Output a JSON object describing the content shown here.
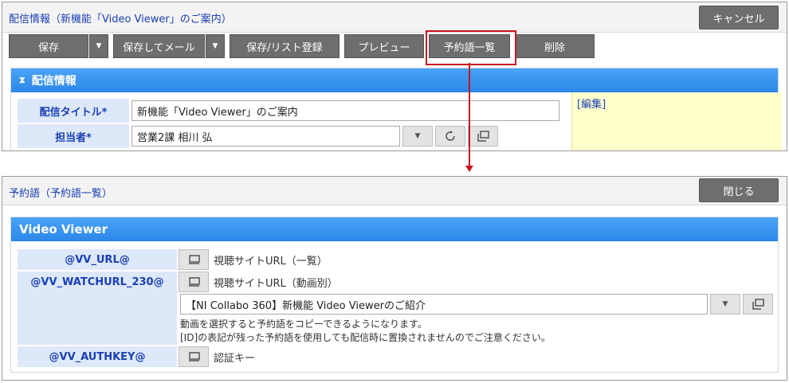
{
  "top_panel": {
    "title": "配信情報（新機能「Video Viewer」のご案内）",
    "cancel_label": "キャンセル",
    "toolbar": {
      "save": "保存",
      "save_and_mail": "保存してメール",
      "save_list": "保存/リスト登録",
      "preview": "プレビュー",
      "reserved_words": "予約語一覧",
      "delete": "削除"
    },
    "section_title": "配信情報",
    "fields": {
      "title_label": "配信タイトル*",
      "title_value": "新機能「Video Viewer」のご案内",
      "owner_label": "担当者*",
      "owner_value": "営業2課 相川 弘"
    },
    "edit_link": "[編集]"
  },
  "bottom_panel": {
    "title": "予約語（予約語一覧）",
    "close_label": "閉じる",
    "section_title": "Video Viewer",
    "rows": [
      {
        "key": "@VV_URL@",
        "desc": "視聴サイトURL（一覧）"
      },
      {
        "key": "@VV_WATCHURL_230@",
        "desc": "視聴サイトURL（動画別）"
      },
      {
        "key": "@VV_AUTHKEY@",
        "desc": "認証キー"
      }
    ],
    "video_select_value": "【NI Collabo 360】新機能 Video Viewerのご紹介",
    "note_1": "動画を選択すると予約語をコピーできるようになります。",
    "note_2": "[ID]の表記が残った予約語を使用しても配信時に置換されませんのでご注意ください。"
  },
  "colors": {
    "accent_blue": "#2b87ea",
    "highlight_red": "#c8141e",
    "button_gray": "#6e6e6e",
    "label_bg": "#dde8f8",
    "note_bg": "#ffffcc"
  }
}
